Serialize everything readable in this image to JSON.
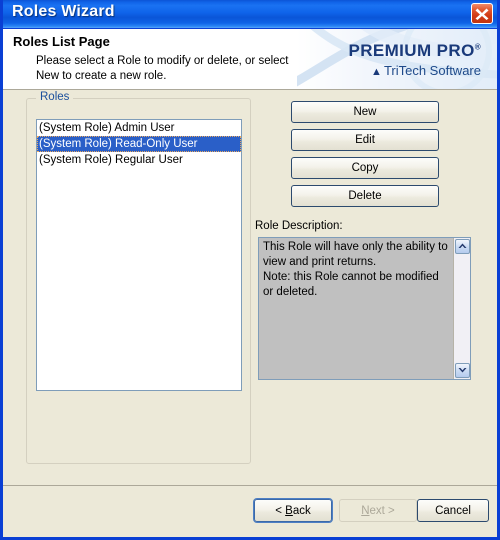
{
  "window": {
    "title": "Roles Wizard",
    "close_icon": "close-icon"
  },
  "header": {
    "title": "Roles List Page",
    "description": "Please select a Role to modify or delete, or select\nNew to create a new role.",
    "logo": {
      "product": "PREMIUM PRO",
      "registered_mark": "®",
      "company": "TriTech Software",
      "company_mark": "▲"
    }
  },
  "roles_group": {
    "label": "Roles",
    "items": [
      {
        "label": "(System Role) Admin User",
        "selected": false
      },
      {
        "label": "(System Role) Read-Only User",
        "selected": true
      },
      {
        "label": "(System Role) Regular User",
        "selected": false
      }
    ]
  },
  "actions": {
    "new_label": "New",
    "edit_label": "Edit",
    "copy_label": "Copy",
    "delete_label": "Delete"
  },
  "role_description": {
    "label": "Role Description:",
    "text": "This Role will have only the ability to view and print returns.\nNote: this Role cannot be modified or deleted.",
    "scroll_up_icon": "chevron-up-icon",
    "scroll_down_icon": "chevron-down-icon"
  },
  "footer": {
    "back_label": "< Back",
    "back_accel": "B",
    "next_label": "Next >",
    "next_accel": "N",
    "next_disabled": true,
    "cancel_label": "Cancel"
  },
  "colors": {
    "titlebar_blue": "#1064e8",
    "dialog_bg": "#ece9d8",
    "selection_blue": "#2a5fc8",
    "logo_blue": "#1a3a7a",
    "group_label_blue": "#1a4f9c",
    "close_red": "#d23b16",
    "desc_bg": "#c0c0c0"
  }
}
